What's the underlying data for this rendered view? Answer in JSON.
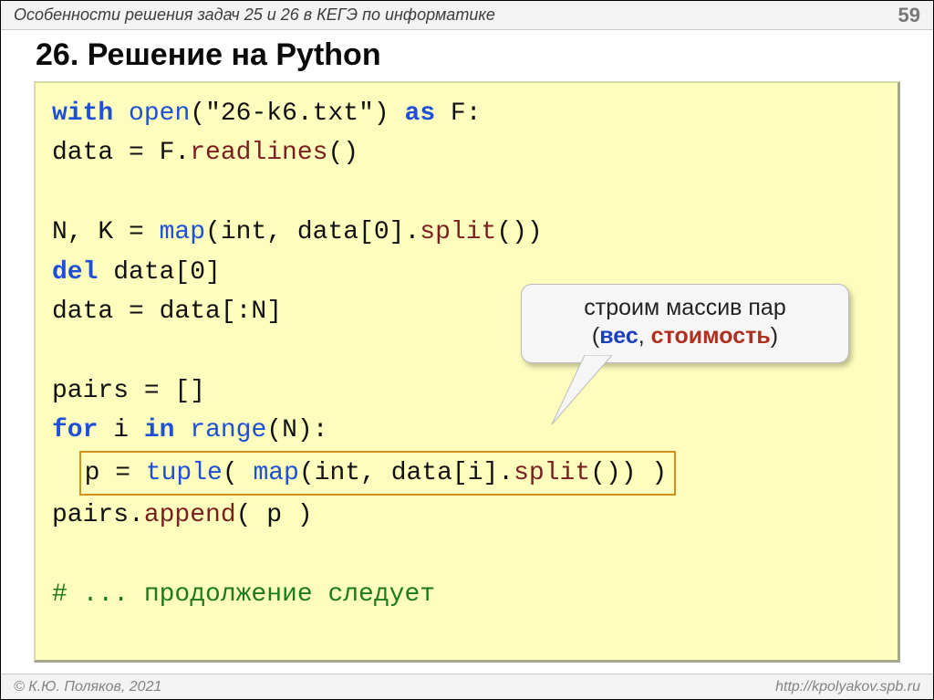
{
  "header": {
    "title": "Особенности решения задач 25 и 26 в КЕГЭ по информатике",
    "page_number": "59"
  },
  "title": "26. Решение на Python",
  "code": {
    "l1": {
      "with": "with",
      "openf": "open",
      "fname": "\"26-k6.txt\"",
      "as": "as",
      "F": " F:"
    },
    "l2": {
      "text_a": "  data = F.",
      "readlines": "readlines",
      "paren": "()"
    },
    "l4": {
      "text_a": "N, K = ",
      "map": "map",
      "mid": "(int, data[0].",
      "split": "split",
      "end": "())"
    },
    "l5": {
      "del": "del",
      "rest": " data[0]"
    },
    "l6": "data = data[:N]",
    "l8": "pairs = []",
    "l9": {
      "for": "for",
      "mid": " i ",
      "in": "in",
      "sp": " ",
      "range": "range",
      "end": "(N):"
    },
    "l10": {
      "text_a": "p = ",
      "tuple": "tuple",
      "mid1": "( ",
      "map": "map",
      "mid2": "(int, data[i].",
      "split": "split",
      "end": "()) )"
    },
    "l11": {
      "text_a": "  pairs.",
      "append": "append",
      "end": "( p )"
    },
    "l13": "# ... продолжение следует"
  },
  "callout": {
    "line1": "строим массив пар",
    "open_paren": "(",
    "weight": "вес",
    "comma": ", ",
    "cost": "стоимость",
    "close_paren": ")"
  },
  "footer": {
    "left": "© К.Ю. Поляков, 2021",
    "right": "http://kpolyakov.spb.ru"
  }
}
